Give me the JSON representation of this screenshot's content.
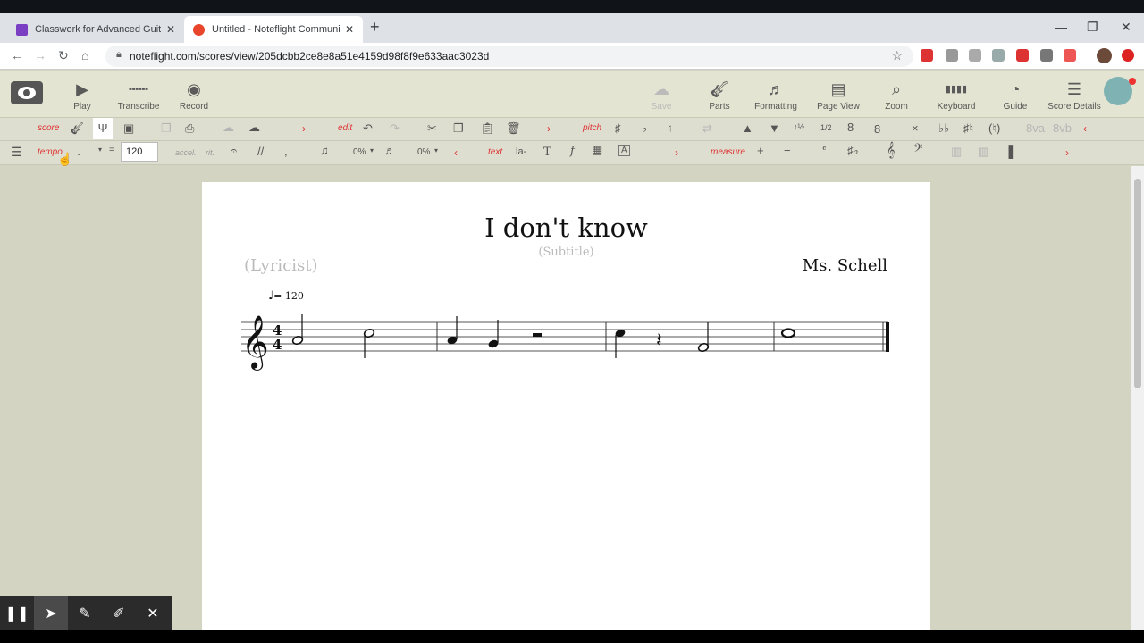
{
  "browser": {
    "tabs": [
      {
        "title": "Classwork for Advanced Guitar 2",
        "favicon_color": "#7b3fc4"
      },
      {
        "title": "Untitled - Noteflight Community",
        "favicon_color": "#e8452c"
      }
    ],
    "url": "noteflight.com/scores/view/205dcbb2ce8e8a51e4159d98f8f9e633aac3023d"
  },
  "toolbar": {
    "left": [
      {
        "label": "Play",
        "icon": "play-icon"
      },
      {
        "label": "Transcribe",
        "icon": "transcribe-icon"
      },
      {
        "label": "Record",
        "icon": "record-icon"
      }
    ],
    "right": [
      {
        "label": "Save",
        "icon": "cloud-save-icon"
      },
      {
        "label": "Parts",
        "icon": "guitar-icon"
      },
      {
        "label": "Formatting",
        "icon": "formatting-icon"
      },
      {
        "label": "Page View",
        "icon": "page-icon"
      },
      {
        "label": "Zoom",
        "icon": "zoom-icon"
      },
      {
        "label": "Keyboard",
        "icon": "keyboard-icon"
      },
      {
        "label": "Guide",
        "icon": "guide-icon"
      },
      {
        "label": "Score Details",
        "icon": "details-icon"
      }
    ]
  },
  "palette": {
    "score": "score",
    "edit": "edit",
    "pitch": "pitch",
    "tempo": "tempo",
    "tempo_value": "120",
    "accel": "accel.",
    "rit": "rit.",
    "pct1": "0%",
    "pct2": "0%",
    "text": "text",
    "lyric": "la-",
    "measure": "measure",
    "half": "1/2"
  },
  "score": {
    "title": "I don't know",
    "subtitle": "(Subtitle)",
    "lyricist": "(Lyricist)",
    "composer": "Ms. Schell",
    "tempo_bpm": "= 120",
    "time_signature": "4/4",
    "measures": [
      [
        "A4 half",
        "C5 half"
      ],
      [
        "A4 quarter",
        "G4 quarter",
        "half rest"
      ],
      [
        "C5 quarter",
        "quarter rest",
        "F4 half"
      ],
      [
        "C5 whole"
      ]
    ]
  },
  "colors": {
    "accent": "#d33333",
    "toolbar_bg": "#e4e4d2",
    "workspace_bg": "#d4d4c2"
  }
}
